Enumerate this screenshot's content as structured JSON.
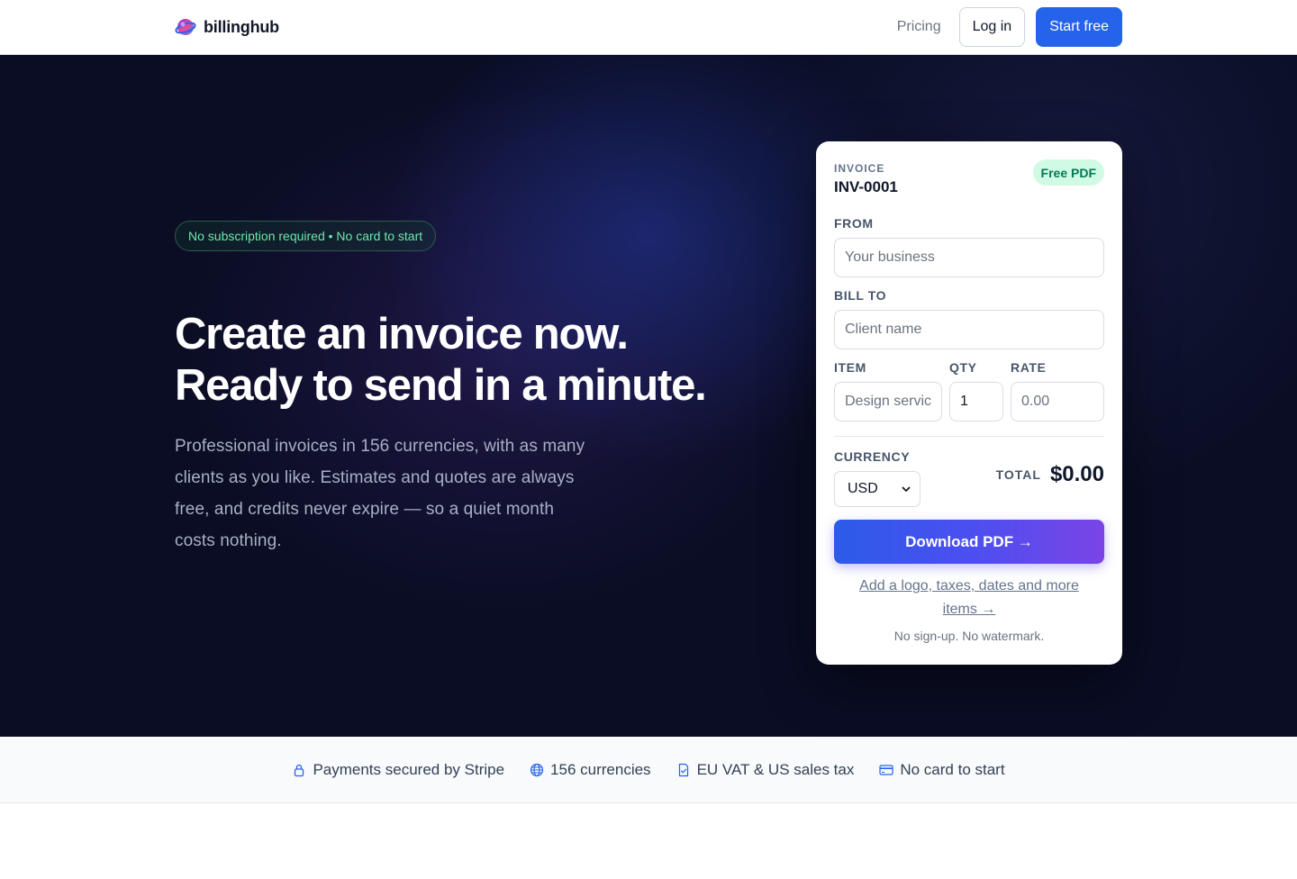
{
  "nav": {
    "brand": "billinghub",
    "pricing": "Pricing",
    "login": "Log in",
    "start": "Start free"
  },
  "hero": {
    "pill": "No subscription required • No card to start",
    "headline_line1": "Create an invoice now.",
    "headline_line2": "Ready to send in a minute.",
    "subtext": "Professional invoices in 156 currencies, with as many clients as you like. Estimates and quotes are always free, and credits never expire — so a quiet month costs nothing."
  },
  "invoice_card": {
    "label": "INVOICE",
    "number": "INV-0001",
    "badge": "Free PDF",
    "from_label": "FROM",
    "from_placeholder": "Your business",
    "bill_to_label": "BILL TO",
    "bill_to_placeholder": "Client name",
    "item_label": "ITEM",
    "item_placeholder": "Design services",
    "qty_label": "QTY",
    "qty_value": "1",
    "rate_label": "RATE",
    "rate_placeholder": "0.00",
    "currency_label": "CURRENCY",
    "currency_value": "USD",
    "total_label": "TOTAL",
    "total_value": "$0.00",
    "download_button": "Download PDF →",
    "more_link": "Add a logo, taxes, dates and more items →",
    "note": "No sign-up. No watermark."
  },
  "trust_bar": {
    "items": [
      {
        "label": "Payments secured by Stripe",
        "icon": "lock-icon"
      },
      {
        "label": "156 currencies",
        "icon": "globe-icon"
      },
      {
        "label": "EU VAT & US sales tax",
        "icon": "document-check-icon"
      },
      {
        "label": "No card to start",
        "icon": "credit-card-icon"
      }
    ]
  },
  "colors": {
    "accent": "#2563eb",
    "hero_bg": "#0a0d24",
    "pill_text": "#6ee7a8",
    "badge_bg": "#d1fae5",
    "badge_text": "#047857"
  }
}
